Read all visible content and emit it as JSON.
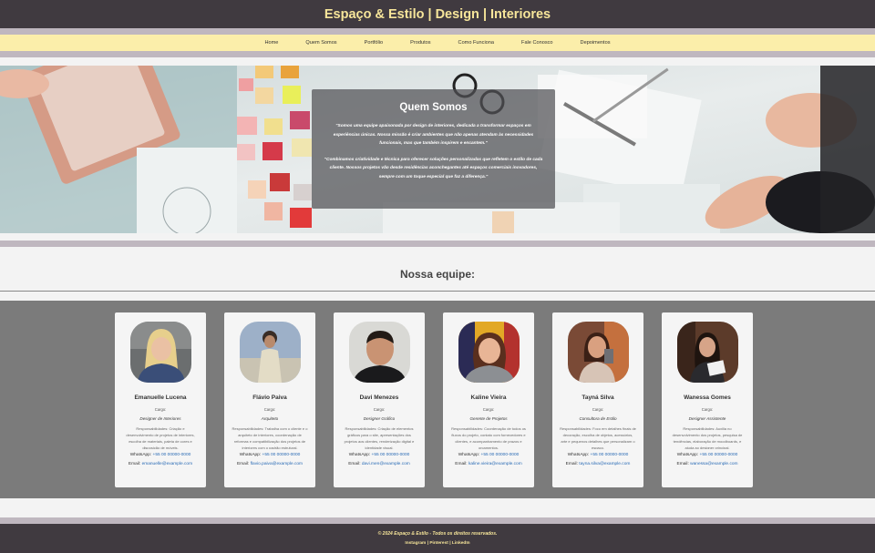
{
  "header": {
    "title": "Espaço & Estilo | Design | Interiores"
  },
  "nav": {
    "items": [
      "Home",
      "Quem Somos",
      "Portfólio",
      "Produtos",
      "Como Funciona",
      "Fale Conosco",
      "Depoimentos"
    ]
  },
  "hero": {
    "title": "Quem Somos",
    "paragraph1": "\"Somos uma equipe apaixonada por design de interiores, dedicada a transformar espaços em experiências únicas. Nossa missão é criar ambientes que não apenas atendam às necessidades funcionais, mas que também inspirem e encantem.\"",
    "paragraph2": "\"Combinamos criatividade e técnica para oferecer soluções personalizadas que refletem o estilo de cada cliente. Nossos projetos vão desde residências aconchegantes até espaços comerciais inovadores, sempre com um toque especial que faz a diferença.\""
  },
  "team": {
    "heading": "Nossa equipe:",
    "cargo_label": "Cargo:",
    "whatsapp_label": "WhatsApp:",
    "email_label": "Email:",
    "members": [
      {
        "name": "Emanuelle Lucena",
        "role": "Designer de Interiores",
        "resp": "Responsabilidades: Criação e desenvolvimento de projetos de interiores, escolha de materiais, paleta de cores e disposição de móveis.",
        "whatsapp": "+55 00 00000-0000",
        "email": "emanuelle@example.com"
      },
      {
        "name": "Flávio Paiva",
        "role": "Arquiteto",
        "resp": "Responsabilidades: Trabalha com o cliente e o arquiteto de interiores, coordenação de reformas e compatibilização dos projetos de interiores com o padrão estrutural.",
        "whatsapp": "+55 00 00000-0000",
        "email": "flavio.paiva@example.com"
      },
      {
        "name": "Davi Menezes",
        "role": "Designer Gráfico",
        "resp": "Responsabilidades: Criação de elementos gráficos para o site, apresentações dos projetos aos clientes, renderização digital e identidade visual.",
        "whatsapp": "+55 00 00000-0000",
        "email": "davi.men@example.com"
      },
      {
        "name": "Kaline Vieira",
        "role": "Gerente de Projetos",
        "resp": "Responsabilidades: Coordenação de todos os fluxos do projeto, contato com fornecedores e clientes, e acompanhamento de prazos e orçamentos.",
        "whatsapp": "+55 00 00000-0000",
        "email": "kaline.vieira@example.com"
      },
      {
        "name": "Tayná Silva",
        "role": "Consultora de Estilo",
        "resp": "Responsabilidades: Foco em detalhes finais de decoração, escolha de objetos, acessórios, arte e pequenos detalhes que personalizam o espaço.",
        "whatsapp": "+55 00 00000-0000",
        "email": "tayna.silva@example.com"
      },
      {
        "name": "Wanessa Gomes",
        "role": "Designer Assistente",
        "resp": "Responsabilidades: Auxilia no desenvolvimento dos projetos, pesquisa de tendências, elaboração de moodboards, e ajuda ao designer principal.",
        "whatsapp": "+55 00 00000-0000",
        "email": "wanessa@example.com"
      }
    ]
  },
  "footer": {
    "copyright": "© 2024 Espaço & Estilo - Todos os direitos reservados.",
    "social": [
      "Instagram",
      "Pinterest",
      "LinkedIn"
    ]
  }
}
